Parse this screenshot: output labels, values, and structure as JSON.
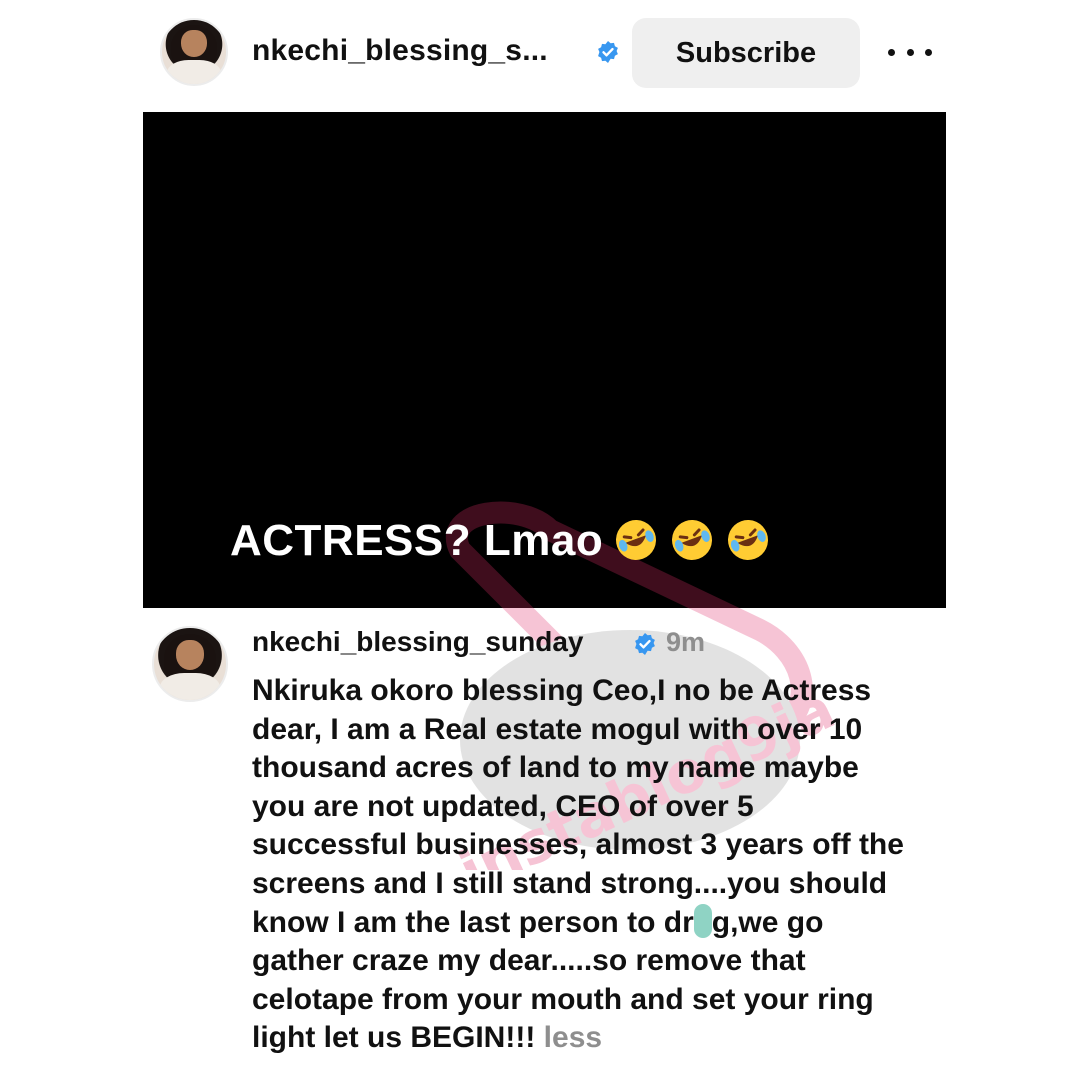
{
  "post": {
    "username": "nkechi_blessing_s...",
    "subscribe_label": "Subscribe",
    "more_icon": "ellipsis-icon",
    "verified_icon": "verified-badge-icon",
    "media_caption": "ACTRESS? Lmao",
    "caption_emoji": "rolling-on-floor-laughing-emoji"
  },
  "comment": {
    "username": "nkechi_blessing_sunday",
    "timestamp": "9m",
    "lines": [
      "Nkiruka okoro blessing Ceo,I no be Actress",
      "dear, I am a Real estate mogul with over 10",
      "thousand acres of land to my name maybe",
      "you are not updated, CEO of over 5",
      "successful businesses, almost 3 years off the",
      "screens and I still stand strong....you should",
      "know I am the last person to dr",
      "g,we go",
      "gather craze my dear.....so remove  that",
      "celotape from your mouth and set your ring",
      "light let us BEGIN!!!"
    ],
    "less_label": "less"
  },
  "colors": {
    "verified_blue": "#3897f0",
    "muted_text": "#8e8e8e",
    "button_bg": "#efefef",
    "watermark_pink": "#e0306a"
  }
}
